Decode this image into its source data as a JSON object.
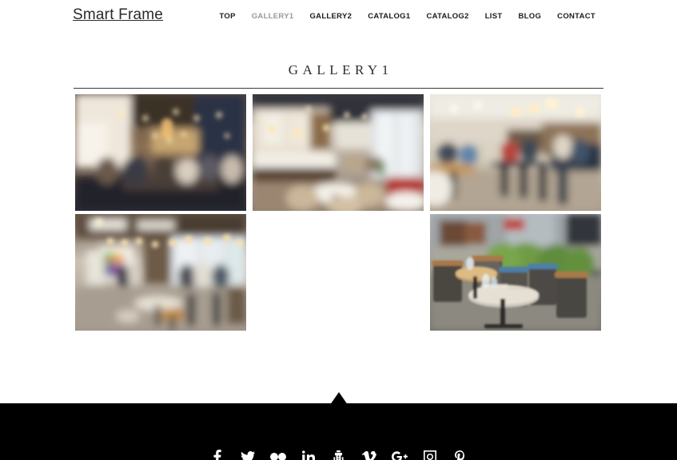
{
  "header": {
    "logo": "Smart Frame",
    "nav": [
      {
        "label": "TOP",
        "current": false
      },
      {
        "label": "GALLERY1",
        "current": true
      },
      {
        "label": "GALLERY2",
        "current": false
      },
      {
        "label": "CATALOG1",
        "current": false
      },
      {
        "label": "CATALOG2",
        "current": false
      },
      {
        "label": "LIST",
        "current": false
      },
      {
        "label": "BLOG",
        "current": false
      },
      {
        "label": "CONTACT",
        "current": false
      }
    ]
  },
  "main": {
    "title": "GALLERY1",
    "gallery": {
      "items": [
        {
          "alt": "Blurred cafe interior with warm pendant lights and dark blue walls",
          "empty": false
        },
        {
          "alt": "Bright modern cafe with industrial ceiling, counter and round tables",
          "empty": false
        },
        {
          "alt": "Cafe with bar stools, seated patrons and hanging lamps",
          "empty": false
        },
        {
          "alt": "Cafe interior with string lights and colorful wall sign",
          "empty": false
        },
        {
          "alt": "",
          "empty": true
        },
        {
          "alt": "Outdoor terrace with bistro chairs, tables and green topiary",
          "empty": false
        }
      ]
    }
  },
  "scroll_top": {
    "label": "Back to top"
  },
  "footer": {
    "social": [
      {
        "name": "facebook",
        "label": "Facebook"
      },
      {
        "name": "twitter",
        "label": "Twitter"
      },
      {
        "name": "flickr",
        "label": "Flickr"
      },
      {
        "name": "linkedin",
        "label": "LinkedIn"
      },
      {
        "name": "youtube",
        "label": "YouTube"
      },
      {
        "name": "vimeo",
        "label": "Vimeo"
      },
      {
        "name": "googleplus",
        "label": "Google Plus"
      },
      {
        "name": "instagram",
        "label": "Instagram"
      },
      {
        "name": "pinterest",
        "label": "Pinterest"
      }
    ]
  },
  "colors": {
    "page_background": "#ffffff",
    "text": "#1c1c1c",
    "nav_current": "#9a9a9a",
    "footer_background": "#000000",
    "rule": "#3a3a3a"
  }
}
